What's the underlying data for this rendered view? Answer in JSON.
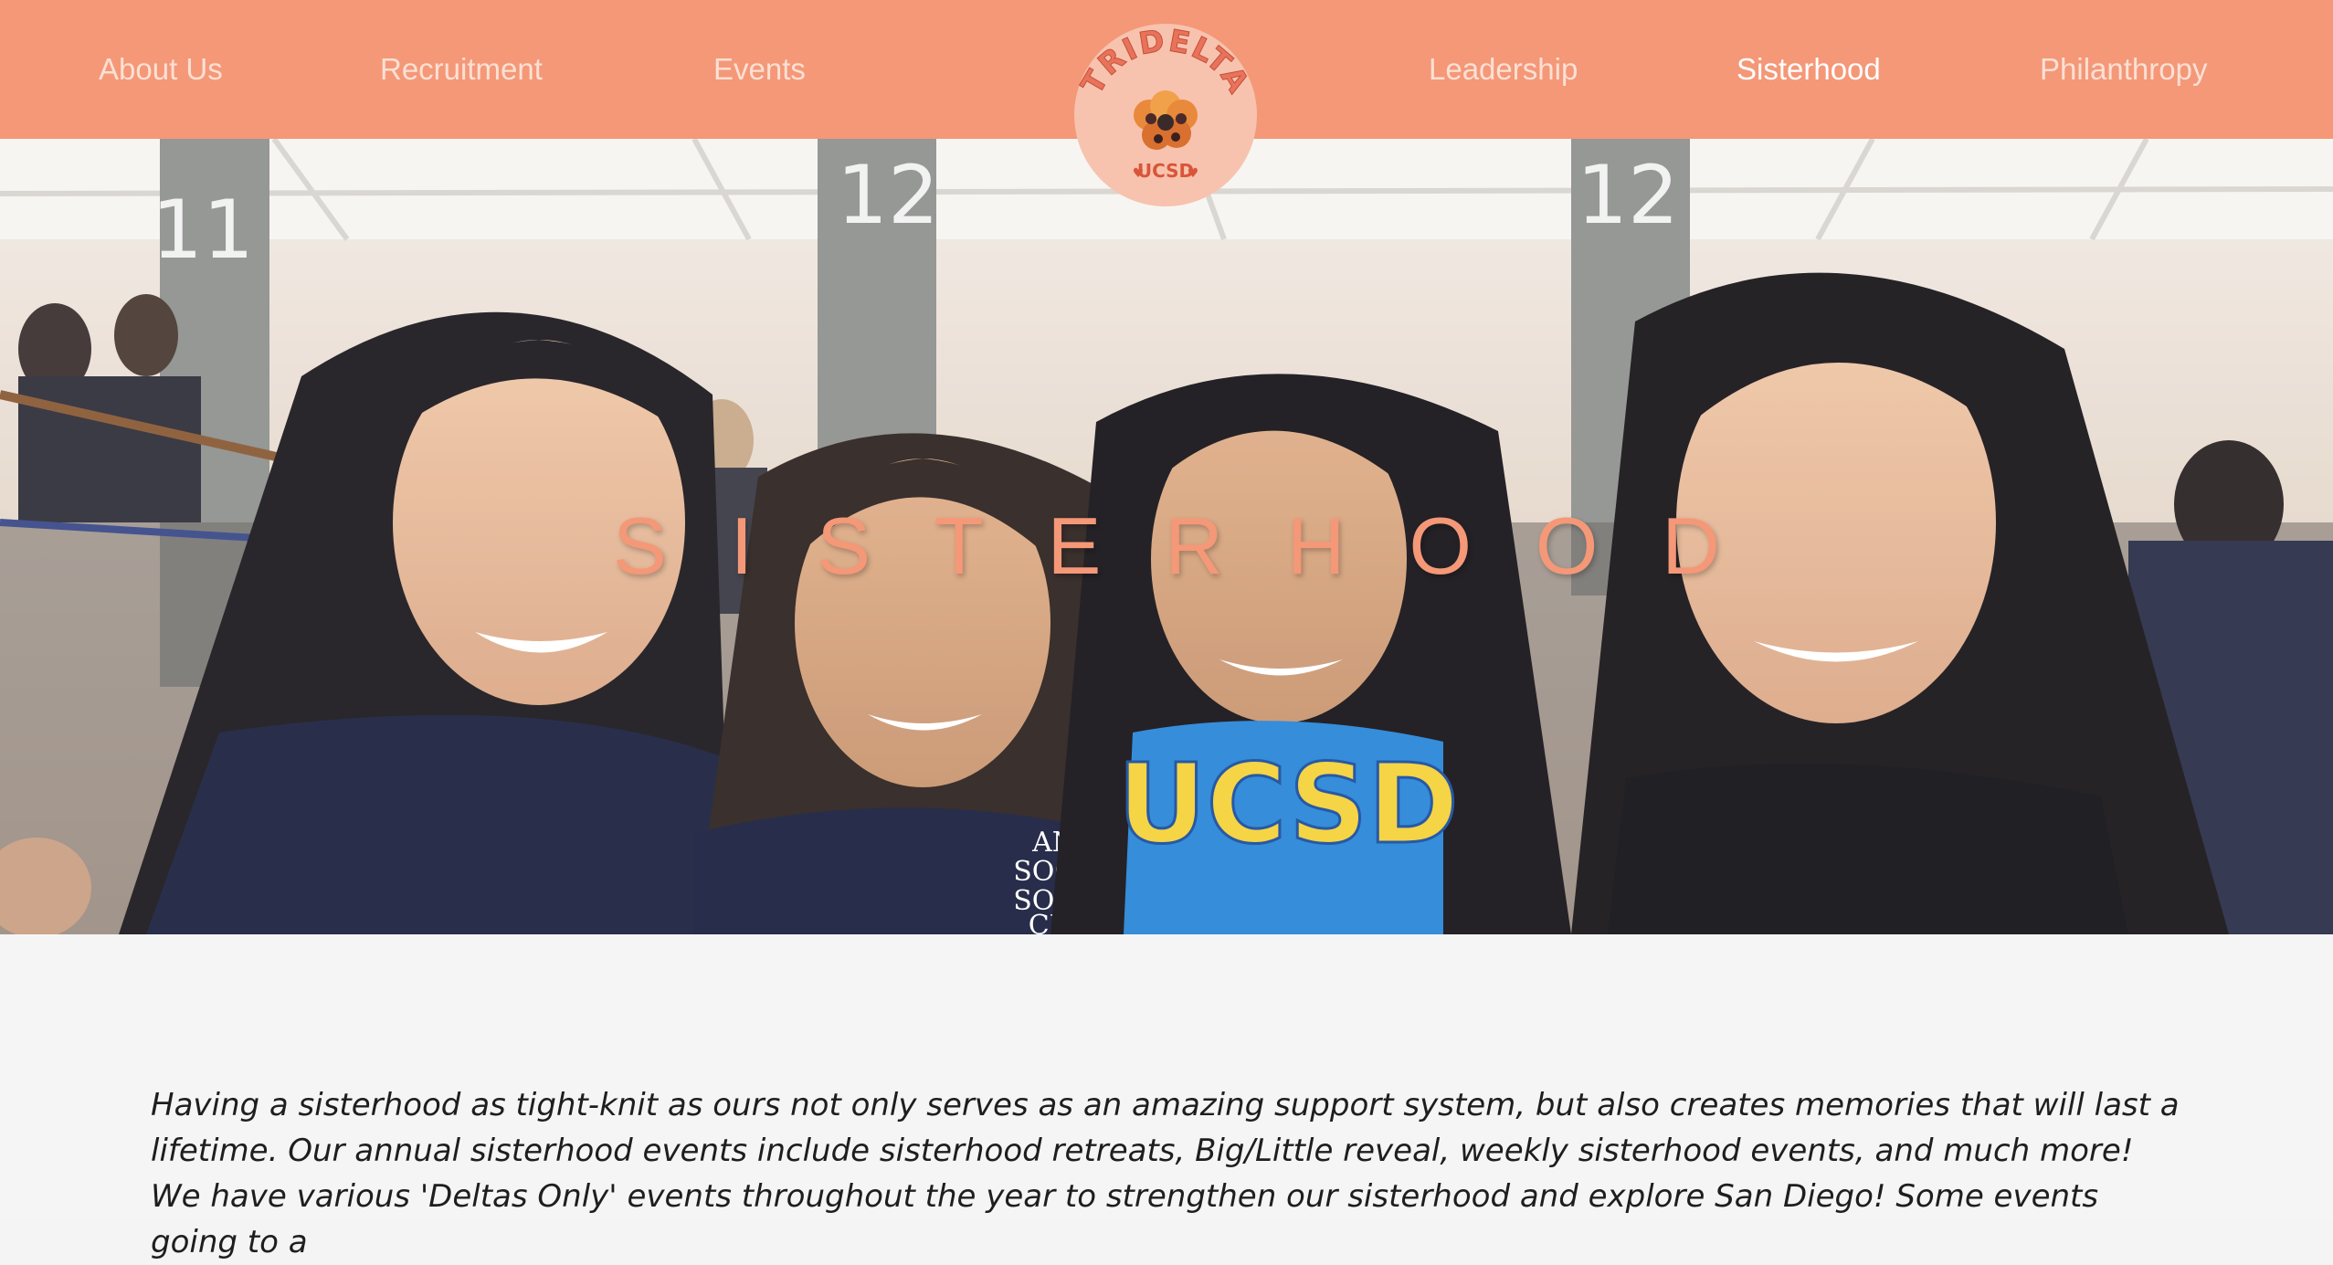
{
  "nav": {
    "left_items": [
      {
        "label": "About Us"
      },
      {
        "label": "Recruitment"
      },
      {
        "label": "Events"
      }
    ],
    "right_items": [
      {
        "label": "Leadership"
      },
      {
        "label": "Sisterhood",
        "active": true
      },
      {
        "label": "Philanthropy"
      }
    ],
    "logo": {
      "top_text": "TRIDELTA",
      "bottom_text": "UCSD"
    }
  },
  "hero": {
    "title": "SISTERHOOD",
    "jersey_numbers": [
      "11",
      "12",
      "12"
    ],
    "shirt_text": [
      "ANTI",
      "SOCIAL",
      "SOCIAL",
      "CLUB"
    ],
    "shirt_text_2": "UCSD"
  },
  "content": {
    "paragraph": "Having a sisterhood as tight-knit as ours not only serves as an amazing support system, but also creates memories that will last a lifetime. Our annual sisterhood events include sisterhood retreats, Big/Little reveal, weekly sisterhood events, and much more! We have various 'Deltas Only' events throughout the year to strengthen our sisterhood and explore San Diego! Some events going to a"
  },
  "colors": {
    "brand": "#f49878",
    "nav_text": "#fbe0d4",
    "nav_active": "#ffffff",
    "body_text": "#1e1e1e"
  }
}
